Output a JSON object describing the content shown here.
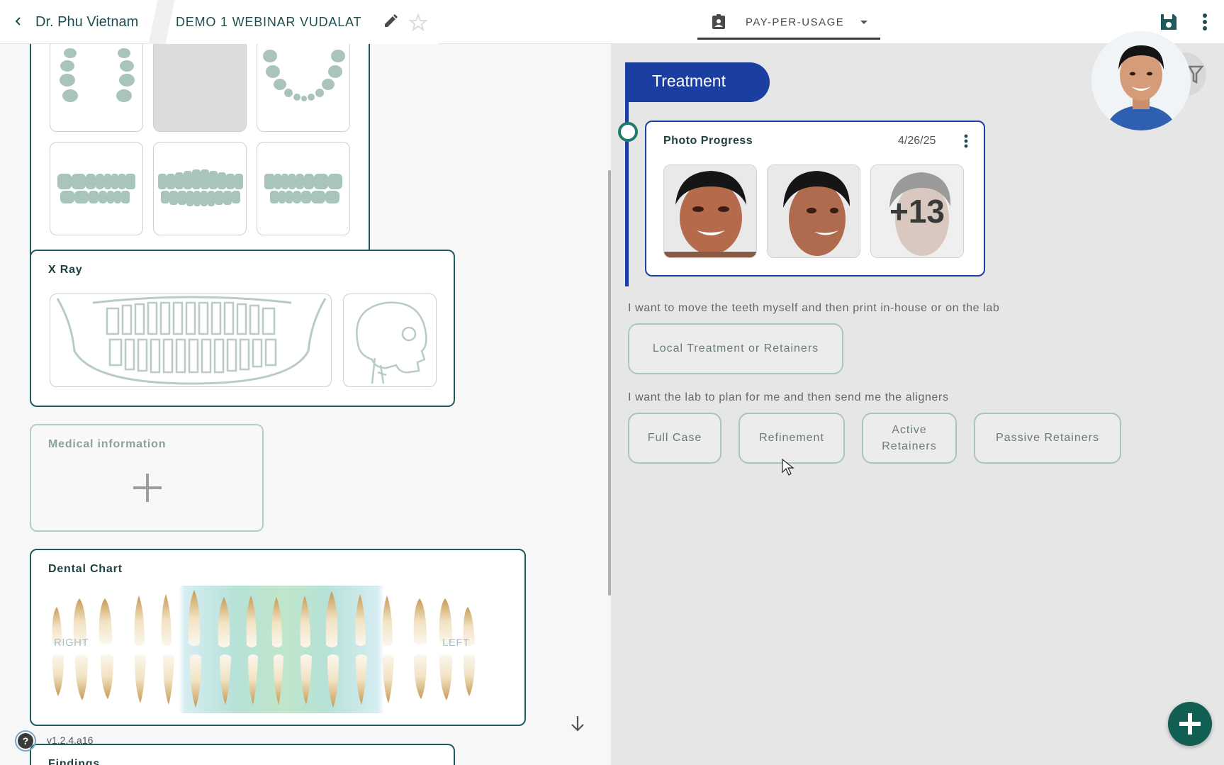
{
  "header": {
    "doctor_name": "Dr. Phu Vietnam",
    "case_title": "DEMO 1 WEBINAR VUDALAT",
    "plan_label": "PAY-PER-USAGE",
    "icons": [
      "chevron-left-icon",
      "pencil-icon",
      "star-icon",
      "clipboard-user-icon",
      "caret-down-icon",
      "save-icon",
      "more-vert-icon"
    ]
  },
  "left": {
    "xray_title": "X Ray",
    "medical_title": "Medical information",
    "dental_chart_title": "Dental Chart",
    "dental_chart_right": "RIGHT",
    "dental_chart_left": "LEFT",
    "findings_title": "Findings",
    "version": "v1.2.4.a16"
  },
  "treatment": {
    "label": "Treatment",
    "photo_card": {
      "title": "Photo Progress",
      "date": "4/26/25",
      "more_count": "+13"
    },
    "local_hint": "I want to move the teeth myself and then print in-house or on the lab",
    "local_button": "Local Treatment or Retainers",
    "lab_hint": "I want the lab to plan for me and then send me the aligners",
    "lab_buttons": [
      "Full Case",
      "Refinement",
      "Active\nRetainers",
      "Passive Retainers"
    ]
  },
  "colors": {
    "primary_teal": "#1f5a5a",
    "timeline_blue": "#1a3fa0",
    "fab_green": "#115e52"
  }
}
